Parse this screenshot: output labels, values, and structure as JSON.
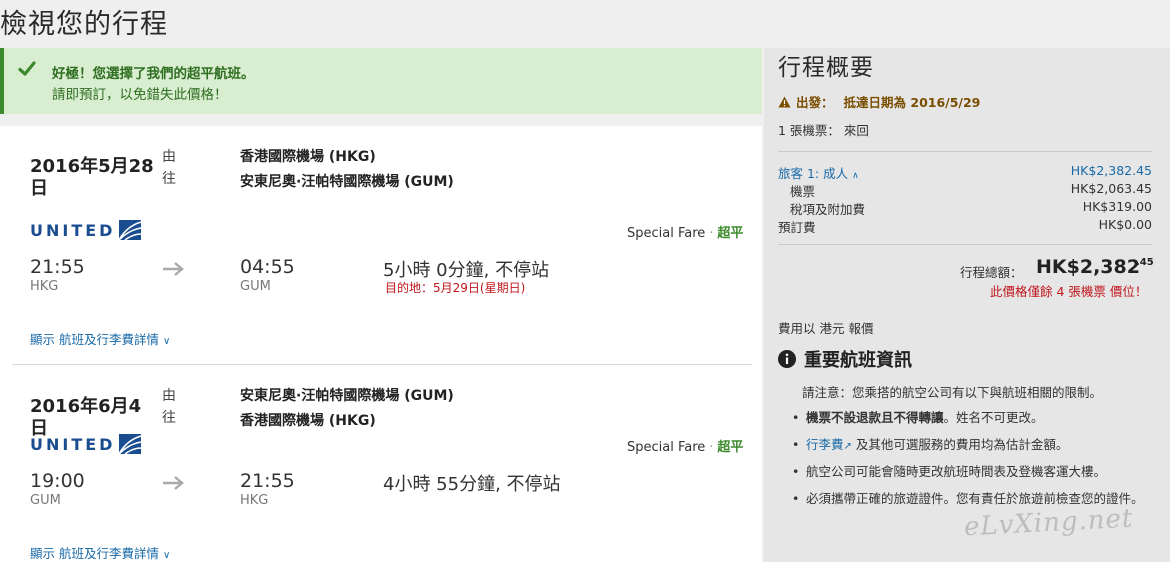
{
  "page": {
    "title": "檢視您的行程"
  },
  "alert": {
    "line1": "好極！您選擇了我們的超平航班。",
    "line2": "請即預訂，以免錯失此價格！",
    "color": "#3d8a2e"
  },
  "flights": [
    {
      "date": "2016年5月28日",
      "from_to_label": "由往",
      "origin": "香港國際機場 (HKG)",
      "destination": "安東尼奧·汪帕特國際機場 (GUM)",
      "airline": "UNITED",
      "fare_name": "Special Fare",
      "fare_tag": "超平",
      "depart_time": "21:55",
      "depart_code": "HKG",
      "arrive_time": "04:55",
      "arrive_code": "GUM",
      "duration": "5小時 0分鐘, 不停站",
      "arrival_note": "目的地：5月29日(星期日)",
      "details_link": "顯示 航班及行李費詳情"
    },
    {
      "date": "2016年6月4日",
      "from_to_label": "由往",
      "origin": "安東尼奧·汪帕特國際機場 (GUM)",
      "destination": "香港國際機場 (HKG)",
      "airline": "UNITED",
      "fare_name": "Special Fare",
      "fare_tag": "超平",
      "depart_time": "19:00",
      "depart_code": "GUM",
      "arrive_time": "21:55",
      "arrive_code": "HKG",
      "duration": "4小時 55分鐘, 不停站",
      "arrival_note": "",
      "details_link": "顯示 航班及行李費詳情"
    }
  ],
  "summary": {
    "title": "行程概要",
    "warn_label": "出發：",
    "warn_text": "抵達日期為 2016/5/29",
    "tickets": "1 張機票： 來回",
    "traveler_label": "旅客 1: 成人",
    "traveler_total": "HK$2,382.45",
    "ticket_label": "機票",
    "ticket_value": "HK$2,063.45",
    "tax_label": "稅項及附加費",
    "tax_value": "HK$319.00",
    "booking_fee_label": "預訂費",
    "booking_fee_value": "HK$0.00",
    "total_label": "行程總額：",
    "total_value": "HK$2,382",
    "total_cents": ".45",
    "price_note": "此價格僅餘 4 張機票 價位！",
    "currency_note": "費用以 港元 報價",
    "info_title": "重要航班資訊",
    "info_intro": "請注意：您乘搭的航空公司有以下與航班相關的限制。",
    "bullets": {
      "b1_bold": "機票不設退款且不得轉讓",
      "b1_rest": "。姓名不可更改。",
      "b2_link": "行李費",
      "b2_rest": "及其他可選服務的費用均為估計金額。",
      "b3": "航空公司可能會隨時更改航班時間表及登機客運大樓。",
      "b4": "必須攜帶正確的旅遊證件。您有責任於旅遊前檢查您的證件。"
    }
  },
  "watermark": "eLvXing.net",
  "colors": {
    "link": "#1a6aa8",
    "green": "#3d8a2e",
    "red": "#c0161d",
    "united_blue": "#1a4d8f"
  }
}
